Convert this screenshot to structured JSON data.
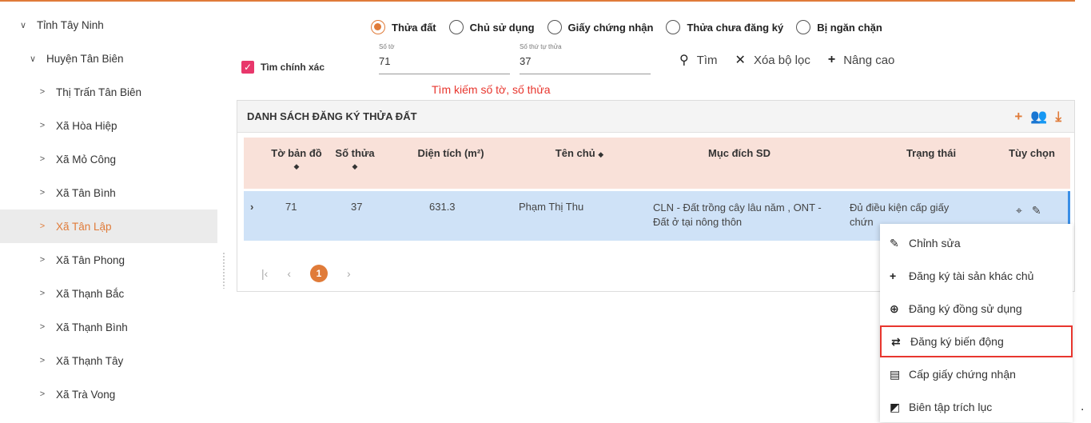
{
  "sidebar": {
    "items": [
      {
        "label": "Tỉnh Tây Ninh",
        "chev": "∨",
        "level": 0
      },
      {
        "label": "Huyện Tân Biên",
        "chev": "∨",
        "level": 1
      },
      {
        "label": "Thị Trấn Tân Biên",
        "chev": ">",
        "level": 2
      },
      {
        "label": "Xã Hòa Hiệp",
        "chev": ">",
        "level": 2
      },
      {
        "label": "Xã Mỏ Công",
        "chev": ">",
        "level": 2
      },
      {
        "label": "Xã Tân Bình",
        "chev": ">",
        "level": 2
      },
      {
        "label": "Xã Tân Lập",
        "chev": ">",
        "level": 2,
        "active": true
      },
      {
        "label": "Xã Tân Phong",
        "chev": ">",
        "level": 2
      },
      {
        "label": "Xã Thạnh Bắc",
        "chev": ">",
        "level": 2
      },
      {
        "label": "Xã Thạnh Bình",
        "chev": ">",
        "level": 2
      },
      {
        "label": "Xã Thạnh Tây",
        "chev": ">",
        "level": 2
      },
      {
        "label": "Xã Trà Vong",
        "chev": ">",
        "level": 2
      }
    ]
  },
  "search": {
    "radios": [
      {
        "label": "Thửa đất",
        "checked": true
      },
      {
        "label": "Chủ sử dụng",
        "checked": false
      },
      {
        "label": "Giấy chứng nhận",
        "checked": false
      },
      {
        "label": "Thửa chưa đăng ký",
        "checked": false
      },
      {
        "label": "Bị ngăn chặn",
        "checked": false
      }
    ],
    "exact_label": "Tìm chính xác",
    "exact_checked": true,
    "sheet_label": "Số tờ",
    "sheet_value": "71",
    "parcel_label": "Số thứ tự thửa",
    "parcel_value": "37",
    "hint": "Tìm kiếm số tờ, số thửa",
    "find_label": "Tìm",
    "clear_label": "Xóa bộ lọc",
    "advanced_label": "Nâng cao"
  },
  "panel": {
    "title": "DANH SÁCH ĐĂNG KÝ THỬA ĐẤT",
    "columns": {
      "sheet": "Tờ bản đồ",
      "parcel": "Số thửa",
      "area": "Diện tích (m²)",
      "owner": "Tên chủ",
      "purpose": "Mục đích SD",
      "status": "Trạng thái",
      "options": "Tùy chọn"
    },
    "row": {
      "sheet": "71",
      "parcel": "37",
      "area": "631.3",
      "owner": "Phạm Thị Thu",
      "purpose_1": "CLN - Đất trồng cây lâu năm , ONT -",
      "purpose_2": "Đất ở tại nông thôn",
      "status_1": "Đủ điều kiện cấp giấy",
      "status_2": "chứn"
    },
    "pager": {
      "current": "1"
    }
  },
  "context_menu": {
    "items": [
      {
        "label": "Chỉnh sửa",
        "icon": "pencil-icon",
        "glyph": "✎"
      },
      {
        "label": "Đăng ký tài sản khác chủ",
        "icon": "plus-icon",
        "glyph": "+"
      },
      {
        "label": "Đăng ký đồng sử dụng",
        "icon": "plus-circle-icon",
        "glyph": "⊕"
      },
      {
        "label": "Đăng ký biến động",
        "icon": "exchange-icon",
        "glyph": "⇄",
        "highlighted": true
      },
      {
        "label": "Cấp giấy chứng nhận",
        "icon": "clipboard-icon",
        "glyph": "▤"
      },
      {
        "label": "Biên tập trích lục",
        "icon": "edit-box-icon",
        "glyph": "◩"
      }
    ]
  },
  "colors": {
    "accent": "#e07b39",
    "highlight": "#e8362e",
    "row_bg": "#cfe2f7",
    "header_bg": "#f9e1d9"
  }
}
